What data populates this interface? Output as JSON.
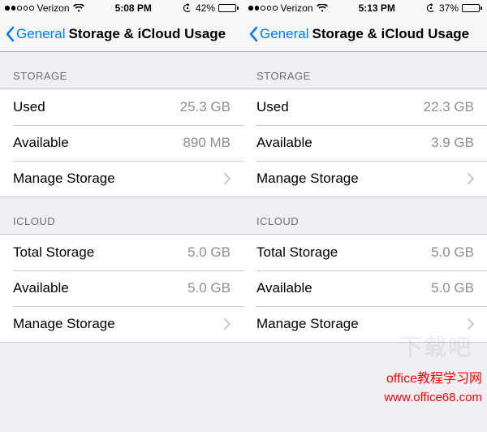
{
  "screens": [
    {
      "status": {
        "carrier": "Verizon",
        "time": "5:08 PM",
        "battery_pct": "42%",
        "battery_fill": 42
      },
      "nav": {
        "back_label": "General",
        "title": "Storage & iCloud Usage"
      },
      "storage": {
        "header": "STORAGE",
        "used_label": "Used",
        "used_value": "25.3 GB",
        "available_label": "Available",
        "available_value": "890 MB",
        "manage_label": "Manage Storage"
      },
      "icloud": {
        "header": "ICLOUD",
        "total_label": "Total Storage",
        "total_value": "5.0 GB",
        "available_label": "Available",
        "available_value": "5.0 GB",
        "manage_label": "Manage Storage"
      }
    },
    {
      "status": {
        "carrier": "Verizon",
        "time": "5:13 PM",
        "battery_pct": "37%",
        "battery_fill": 37
      },
      "nav": {
        "back_label": "General",
        "title": "Storage & iCloud Usage"
      },
      "storage": {
        "header": "STORAGE",
        "used_label": "Used",
        "used_value": "22.3 GB",
        "available_label": "Available",
        "available_value": "3.9 GB",
        "manage_label": "Manage Storage"
      },
      "icloud": {
        "header": "ICLOUD",
        "total_label": "Total Storage",
        "total_value": "5.0 GB",
        "available_label": "Available",
        "available_value": "5.0 GB",
        "manage_label": "Manage Storage"
      }
    }
  ],
  "watermark": {
    "faint": "下载吧",
    "line1": "office教程学习网",
    "line2": "www.office68.com"
  }
}
